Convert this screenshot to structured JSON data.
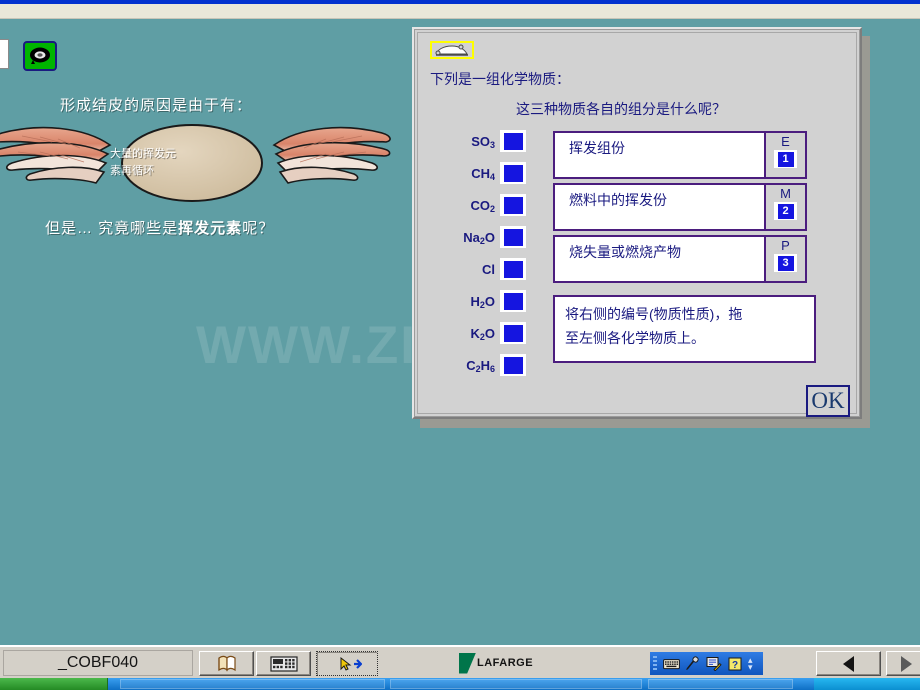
{
  "stage": {
    "background_color": "#5f9ea4",
    "headline": "形成结皮的原因是由于有：",
    "subline_prefix": "但是… 究竟哪些是",
    "subline_bold": "挥发元素",
    "subline_suffix": "呢？",
    "badge_text_line1": "大量的挥发元",
    "badge_text_line2": "素再循环",
    "watermark": "WWW.ZIXIN.COM.CN",
    "green_icon": "cassette-eye-icon"
  },
  "dialog": {
    "title_icon": "car-glyph-icon",
    "line1": "下列是一组化学物质：",
    "line2": "这三种物质各自的组分是什么呢？",
    "accent_color": "#4b1d7e",
    "text_color": "#1a1a80",
    "chip_color": "#1515e0",
    "chemicals": [
      {
        "formula": "SO3",
        "html": "SO<sub>3</sub>"
      },
      {
        "formula": "CH4",
        "html": "CH<sub>4</sub>"
      },
      {
        "formula": "CO2",
        "html": "CO<sub>2</sub>"
      },
      {
        "formula": "Na2O",
        "html": "Na<sub>2</sub>O"
      },
      {
        "formula": "Cl",
        "html": "Cl"
      },
      {
        "formula": "H2O",
        "html": "H<sub>2</sub>O"
      },
      {
        "formula": "K2O",
        "html": "K<sub>2</sub>O"
      },
      {
        "formula": "C2H6",
        "html": "C<sub>2</sub>H<sub>6</sub>"
      }
    ],
    "descriptions": [
      {
        "text": "挥发组份",
        "letter": "E",
        "number": "1"
      },
      {
        "text": "燃料中的挥发份",
        "letter": "M",
        "number": "2"
      },
      {
        "text": "烧失量或燃烧产物",
        "letter": "P",
        "number": "3"
      }
    ],
    "instruction_line1": "将右侧的编号(物质性质)，拖",
    "instruction_line2": "至左侧各化学物质上。",
    "ok_label": "OK"
  },
  "bottom_bar": {
    "field_value": "_COBF040",
    "tools": [
      {
        "name": "book-icon",
        "glyph": "book"
      },
      {
        "name": "calculator-icon",
        "glyph": "calculator"
      },
      {
        "name": "cursor-exit-icon",
        "glyph": "cursor"
      }
    ],
    "brand": "LAFARGE",
    "brand_color": "#00754a",
    "media_tools": [
      {
        "name": "keyboard-icon"
      },
      {
        "name": "microphone-icon"
      },
      {
        "name": "pen-note-icon"
      },
      {
        "name": "help-icon"
      }
    ],
    "nav_prev": "prev-arrow-icon",
    "nav_next": "next-arrow-icon"
  }
}
